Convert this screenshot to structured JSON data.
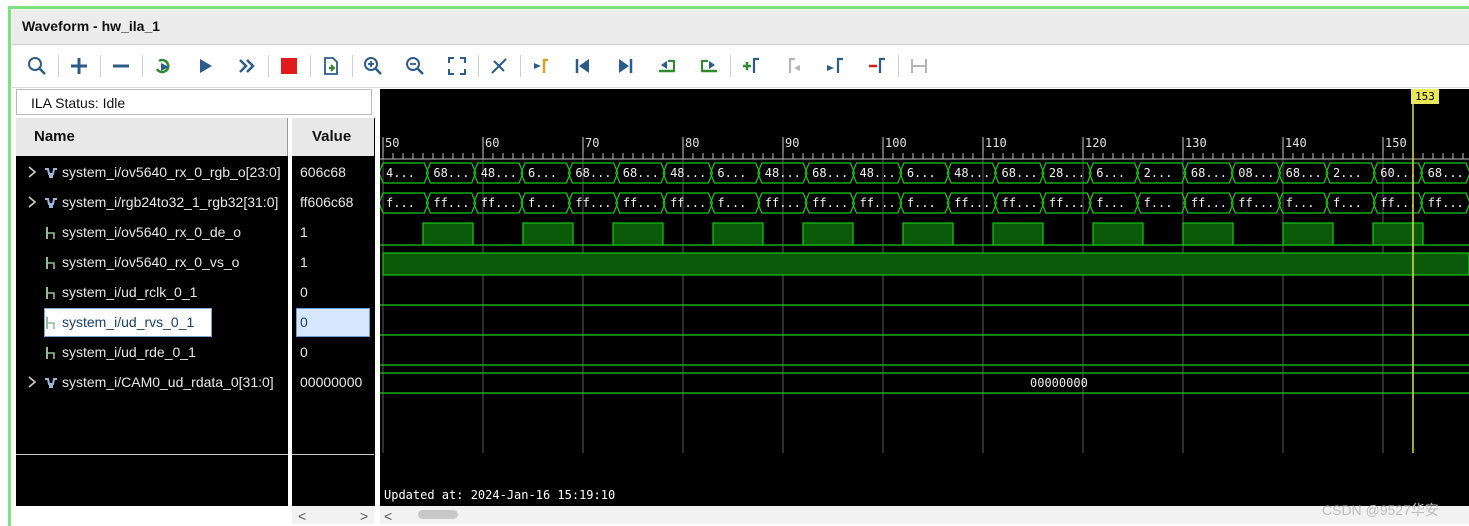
{
  "window": {
    "title": "Waveform - hw_ila_1"
  },
  "toolbar": {
    "buttons": [
      {
        "name": "search-icon"
      },
      {
        "name": "add-icon"
      },
      {
        "name": "remove-icon"
      },
      {
        "name": "run-trigger-immediate-icon"
      },
      {
        "name": "run-icon"
      },
      {
        "name": "run-fast-icon"
      },
      {
        "name": "stop-icon"
      },
      {
        "name": "export-icon"
      },
      {
        "name": "zoom-in-icon"
      },
      {
        "name": "zoom-out-icon"
      },
      {
        "name": "zoom-fit-icon"
      },
      {
        "name": "cursor-icon"
      },
      {
        "name": "go-to-time-zero-icon"
      },
      {
        "name": "go-to-first-icon"
      },
      {
        "name": "go-to-last-icon"
      },
      {
        "name": "previous-transition-icon"
      },
      {
        "name": "next-transition-icon"
      },
      {
        "name": "add-marker-icon"
      },
      {
        "name": "previous-marker-icon"
      },
      {
        "name": "next-marker-icon"
      },
      {
        "name": "swap-cursors-icon"
      },
      {
        "name": "fit-markers-icon"
      }
    ]
  },
  "status": {
    "label": "ILA Status:",
    "value": "Idle"
  },
  "columns": {
    "name": "Name",
    "value": "Value"
  },
  "signals": [
    {
      "name": "system_i/ov5640_rx_0_rgb_o[23:0]",
      "value": "606c68",
      "bus": true
    },
    {
      "name": "system_i/rgb24to32_1_rgb32[31:0]",
      "value": "ff606c68",
      "bus": true
    },
    {
      "name": "system_i/ov5640_rx_0_de_o",
      "value": "1",
      "bus": false
    },
    {
      "name": "system_i/ov5640_rx_0_vs_o",
      "value": "1",
      "bus": false
    },
    {
      "name": "system_i/ud_rclk_0_1",
      "value": "0",
      "bus": false
    },
    {
      "name": "system_i/ud_rvs_0_1",
      "value": "0",
      "bus": false
    },
    {
      "name": "system_i/ud_rde_0_1",
      "value": "0",
      "bus": false
    },
    {
      "name": "system_i/CAM0_ud_rdata_0[31:0]",
      "value": "00000000",
      "bus": true
    }
  ],
  "timeline": {
    "ticks": [
      "50",
      "60",
      "70",
      "80",
      "90",
      "100",
      "110",
      "120",
      "130",
      "140",
      "150"
    ],
    "cursor": "153",
    "bus0_labels": [
      "4...",
      "68...",
      "48...",
      "6...",
      "68...",
      "68...",
      "48...",
      "6...",
      "48...",
      "68...",
      "48...",
      "6...",
      "48...",
      "68...",
      "28...",
      "6...",
      "2...",
      "68...",
      "08...",
      "68...",
      "2...",
      "60...",
      "68..."
    ],
    "bus1_labels": [
      "f...",
      "ff...",
      "ff...",
      "f...",
      "ff...",
      "ff...",
      "ff...",
      "f...",
      "ff...",
      "ff...",
      "ff...",
      "f...",
      "ff...",
      "ff...",
      "ff...",
      "f...",
      "f...",
      "ff...",
      "ff...",
      "f...",
      "f...",
      "ff...",
      "ff..."
    ],
    "rdata_value": "00000000"
  },
  "footer": {
    "updated": "Updated at: 2024-Jan-16 15:19:10"
  },
  "watermark": "CSDN @9527华安"
}
